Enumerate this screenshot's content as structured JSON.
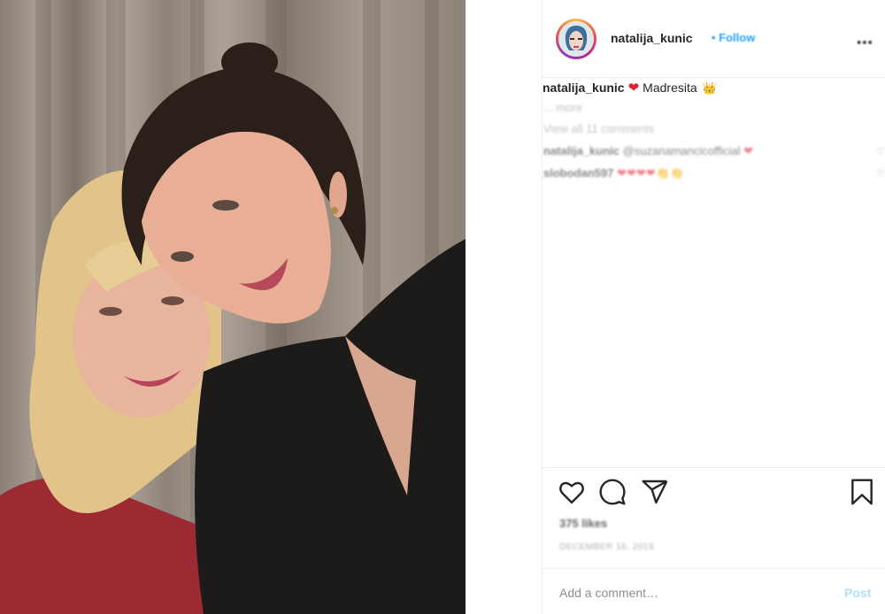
{
  "post": {
    "image_alt": "Photo of two women posing cheek to cheek",
    "username": "natalija_kunic",
    "follow_label": "• Follow",
    "more_options_icon": "more-horizontal-icon",
    "caption": {
      "username": "natalija_kunic",
      "heart": "❤",
      "text": "Madresita",
      "crown": "👑"
    },
    "more_link": "... more",
    "view_all_comments": "View all 11 comments",
    "comments": [
      {
        "username": "natalija_kunic",
        "text": "@suzanamancicofficial",
        "emoji": "❤"
      },
      {
        "username": "slobodan597",
        "text": "",
        "emoji": "❤❤❤❤👏👏"
      }
    ],
    "likes": "375 likes",
    "date": "DECEMBER 16, 2019",
    "add_comment_placeholder": "Add a comment…",
    "post_button": "Post"
  },
  "icons": {
    "like": "heart-icon",
    "comment": "comment-icon",
    "share": "share-icon",
    "save": "bookmark-icon"
  },
  "colors": {
    "link_blue": "#0095f6",
    "post_button_disabled": "#b2dffc",
    "heart_red": "#e0202f",
    "border": "#efefef"
  }
}
